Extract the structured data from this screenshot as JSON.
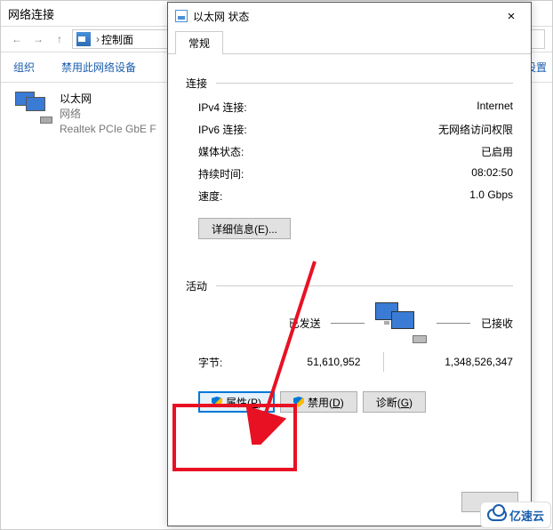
{
  "bg": {
    "title": "网络连接",
    "path_seg": "控制面",
    "toolbar": {
      "org": "组织",
      "disable": "禁用此网络设备",
      "right_item": "设置"
    },
    "adapter": {
      "name": "以太网",
      "sub1": "网络",
      "sub2": "Realtek PCIe GbE F"
    }
  },
  "dialog": {
    "title": "以太网 状态",
    "close": "×",
    "tab": "常规",
    "conn": {
      "head": "连接",
      "ipv4_k": "IPv4 连接:",
      "ipv4_v": "Internet",
      "ipv6_k": "IPv6 连接:",
      "ipv6_v": "无网络访问权限",
      "media_k": "媒体状态:",
      "media_v": "已启用",
      "dur_k": "持续时间:",
      "dur_v": "08:02:50",
      "speed_k": "速度:",
      "speed_v": "1.0 Gbps",
      "details_btn": "详细信息(E)..."
    },
    "activity": {
      "head": "活动",
      "sent": "已发送",
      "recv": "已接收",
      "bytes_lbl": "字节:",
      "sent_v": "51,610,952",
      "recv_v": "1,348,526,347"
    },
    "buttons": {
      "props_pre": "属性(",
      "props_u": "P",
      "props_post": ")",
      "disable_pre": "禁用(",
      "disable_u": "D",
      "disable_post": ")",
      "diag_pre": "诊断(",
      "diag_u": "G",
      "diag_post": ")"
    }
  },
  "watermark": "亿速云"
}
